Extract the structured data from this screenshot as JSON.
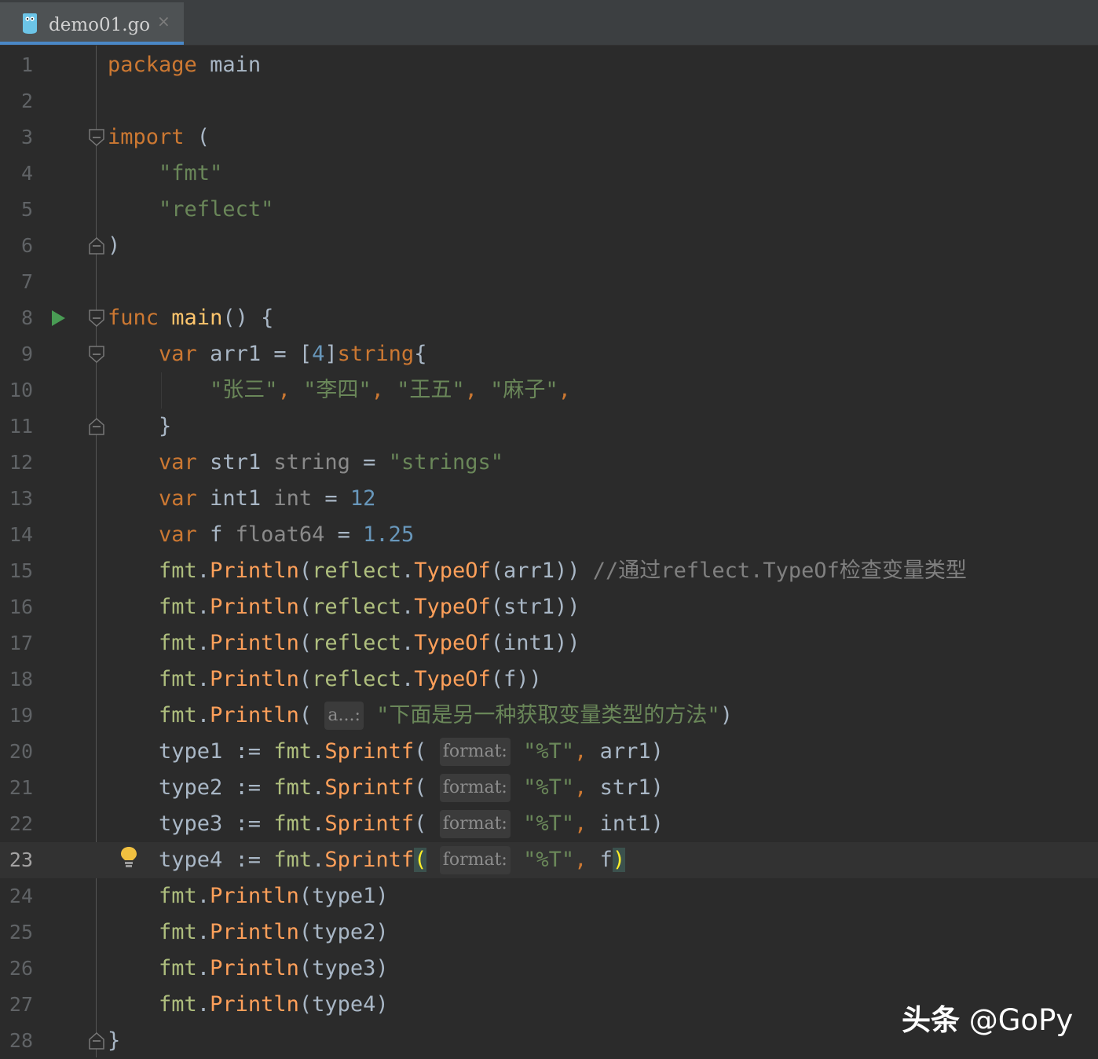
{
  "tab": {
    "filename": "demo01.go",
    "close_glyph": "×",
    "icon": "go-file-icon"
  },
  "editor": {
    "current_line": 23,
    "lines": [
      {
        "n": "1",
        "t": [
          {
            "c": "kw",
            "v": "package"
          },
          {
            "c": "",
            "v": " "
          },
          {
            "c": "typ",
            "v": "main"
          }
        ]
      },
      {
        "n": "2",
        "t": []
      },
      {
        "n": "3",
        "t": [
          {
            "c": "kw",
            "v": "import"
          },
          {
            "c": "",
            "v": " ("
          }
        ]
      },
      {
        "n": "4",
        "t": [
          {
            "c": "",
            "v": "    "
          },
          {
            "c": "str",
            "v": "\"fmt\""
          }
        ]
      },
      {
        "n": "5",
        "t": [
          {
            "c": "",
            "v": "    "
          },
          {
            "c": "str",
            "v": "\"reflect\""
          }
        ]
      },
      {
        "n": "6",
        "t": [
          {
            "c": "",
            "v": ")"
          }
        ]
      },
      {
        "n": "7",
        "t": []
      },
      {
        "n": "8",
        "t": [
          {
            "c": "kw",
            "v": "func"
          },
          {
            "c": "",
            "v": " "
          },
          {
            "c": "fn",
            "v": "main"
          },
          {
            "c": "",
            "v": "() {"
          }
        ]
      },
      {
        "n": "9",
        "t": [
          {
            "c": "",
            "v": "    "
          },
          {
            "c": "kw",
            "v": "var"
          },
          {
            "c": "",
            "v": " arr1 = ["
          },
          {
            "c": "num",
            "v": "4"
          },
          {
            "c": "",
            "v": "]"
          },
          {
            "c": "kw",
            "v": "string"
          },
          {
            "c": "",
            "v": "{"
          }
        ]
      },
      {
        "n": "10",
        "t": [
          {
            "c": "",
            "v": "        "
          },
          {
            "c": "str",
            "v": "\"张三\""
          },
          {
            "c": "kw",
            "v": ", "
          },
          {
            "c": "str",
            "v": "\"李四\""
          },
          {
            "c": "kw",
            "v": ", "
          },
          {
            "c": "str",
            "v": "\"王五\""
          },
          {
            "c": "kw",
            "v": ", "
          },
          {
            "c": "str",
            "v": "\"麻子\""
          },
          {
            "c": "kw",
            "v": ","
          }
        ]
      },
      {
        "n": "11",
        "t": [
          {
            "c": "",
            "v": "    }"
          }
        ]
      },
      {
        "n": "12",
        "t": [
          {
            "c": "",
            "v": "    "
          },
          {
            "c": "kw",
            "v": "var"
          },
          {
            "c": "",
            "v": " str1 "
          },
          {
            "c": "gray",
            "v": "string"
          },
          {
            "c": "",
            "v": " = "
          },
          {
            "c": "str",
            "v": "\"strings\""
          }
        ]
      },
      {
        "n": "13",
        "t": [
          {
            "c": "",
            "v": "    "
          },
          {
            "c": "kw",
            "v": "var"
          },
          {
            "c": "",
            "v": " int1 "
          },
          {
            "c": "gray",
            "v": "int"
          },
          {
            "c": "",
            "v": " = "
          },
          {
            "c": "num",
            "v": "12"
          }
        ]
      },
      {
        "n": "14",
        "t": [
          {
            "c": "",
            "v": "    "
          },
          {
            "c": "kw",
            "v": "var"
          },
          {
            "c": "",
            "v": " f "
          },
          {
            "c": "gray",
            "v": "float64"
          },
          {
            "c": "",
            "v": " = "
          },
          {
            "c": "num",
            "v": "1.25"
          }
        ]
      },
      {
        "n": "15",
        "t": [
          {
            "c": "",
            "v": "    "
          },
          {
            "c": "pkg",
            "v": "fmt"
          },
          {
            "c": "",
            "v": "."
          },
          {
            "c": "mth",
            "v": "Println"
          },
          {
            "c": "",
            "v": "("
          },
          {
            "c": "pkg",
            "v": "reflect"
          },
          {
            "c": "",
            "v": "."
          },
          {
            "c": "mth",
            "v": "TypeOf"
          },
          {
            "c": "",
            "v": "(arr1)) "
          },
          {
            "c": "cmt",
            "v": "//通过reflect.TypeOf检查变量类型"
          }
        ]
      },
      {
        "n": "16",
        "t": [
          {
            "c": "",
            "v": "    "
          },
          {
            "c": "pkg",
            "v": "fmt"
          },
          {
            "c": "",
            "v": "."
          },
          {
            "c": "mth",
            "v": "Println"
          },
          {
            "c": "",
            "v": "("
          },
          {
            "c": "pkg",
            "v": "reflect"
          },
          {
            "c": "",
            "v": "."
          },
          {
            "c": "mth",
            "v": "TypeOf"
          },
          {
            "c": "",
            "v": "(str1))"
          }
        ]
      },
      {
        "n": "17",
        "t": [
          {
            "c": "",
            "v": "    "
          },
          {
            "c": "pkg",
            "v": "fmt"
          },
          {
            "c": "",
            "v": "."
          },
          {
            "c": "mth",
            "v": "Println"
          },
          {
            "c": "",
            "v": "("
          },
          {
            "c": "pkg",
            "v": "reflect"
          },
          {
            "c": "",
            "v": "."
          },
          {
            "c": "mth",
            "v": "TypeOf"
          },
          {
            "c": "",
            "v": "(int1))"
          }
        ]
      },
      {
        "n": "18",
        "t": [
          {
            "c": "",
            "v": "    "
          },
          {
            "c": "pkg",
            "v": "fmt"
          },
          {
            "c": "",
            "v": "."
          },
          {
            "c": "mth",
            "v": "Println"
          },
          {
            "c": "",
            "v": "("
          },
          {
            "c": "pkg",
            "v": "reflect"
          },
          {
            "c": "",
            "v": "."
          },
          {
            "c": "mth",
            "v": "TypeOf"
          },
          {
            "c": "",
            "v": "(f))"
          }
        ]
      },
      {
        "n": "19",
        "t": [
          {
            "c": "",
            "v": "    "
          },
          {
            "c": "pkg",
            "v": "fmt"
          },
          {
            "c": "",
            "v": "."
          },
          {
            "c": "mth",
            "v": "Println"
          },
          {
            "c": "",
            "v": "( "
          },
          {
            "c": "hint",
            "v": "a...:"
          },
          {
            "c": "",
            "v": " "
          },
          {
            "c": "str",
            "v": "\"下面是另一种获取变量类型的方法\""
          },
          {
            "c": "",
            "v": ")"
          }
        ]
      },
      {
        "n": "20",
        "t": [
          {
            "c": "",
            "v": "    type1 := "
          },
          {
            "c": "pkg",
            "v": "fmt"
          },
          {
            "c": "",
            "v": "."
          },
          {
            "c": "mth",
            "v": "Sprintf"
          },
          {
            "c": "",
            "v": "( "
          },
          {
            "c": "hint",
            "v": "format:"
          },
          {
            "c": "",
            "v": " "
          },
          {
            "c": "str",
            "v": "\"%T\""
          },
          {
            "c": "kw",
            "v": ", "
          },
          {
            "c": "",
            "v": "arr1)"
          }
        ]
      },
      {
        "n": "21",
        "t": [
          {
            "c": "",
            "v": "    type2 := "
          },
          {
            "c": "pkg",
            "v": "fmt"
          },
          {
            "c": "",
            "v": "."
          },
          {
            "c": "mth",
            "v": "Sprintf"
          },
          {
            "c": "",
            "v": "( "
          },
          {
            "c": "hint",
            "v": "format:"
          },
          {
            "c": "",
            "v": " "
          },
          {
            "c": "str",
            "v": "\"%T\""
          },
          {
            "c": "kw",
            "v": ", "
          },
          {
            "c": "",
            "v": "str1)"
          }
        ]
      },
      {
        "n": "22",
        "t": [
          {
            "c": "",
            "v": "    type3 := "
          },
          {
            "c": "pkg",
            "v": "fmt"
          },
          {
            "c": "",
            "v": "."
          },
          {
            "c": "mth",
            "v": "Sprintf"
          },
          {
            "c": "",
            "v": "( "
          },
          {
            "c": "hint",
            "v": "format:"
          },
          {
            "c": "",
            "v": " "
          },
          {
            "c": "str",
            "v": "\"%T\""
          },
          {
            "c": "kw",
            "v": ", "
          },
          {
            "c": "",
            "v": "int1)"
          }
        ]
      },
      {
        "n": "23",
        "t": [
          {
            "c": "",
            "v": "    type4 := "
          },
          {
            "c": "pkg",
            "v": "fmt"
          },
          {
            "c": "",
            "v": "."
          },
          {
            "c": "mth",
            "v": "Sprintf"
          },
          {
            "c": "brace-hl",
            "v": "("
          },
          {
            "c": "",
            "v": " "
          },
          {
            "c": "hint",
            "v": "format:"
          },
          {
            "c": "",
            "v": " "
          },
          {
            "c": "str",
            "v": "\"%T\""
          },
          {
            "c": "kw",
            "v": ", "
          },
          {
            "c": "",
            "v": "f"
          },
          {
            "c": "brace-hl",
            "v": ")"
          }
        ]
      },
      {
        "n": "24",
        "t": [
          {
            "c": "",
            "v": "    "
          },
          {
            "c": "pkg",
            "v": "fmt"
          },
          {
            "c": "",
            "v": "."
          },
          {
            "c": "mth",
            "v": "Println"
          },
          {
            "c": "",
            "v": "(type1)"
          }
        ]
      },
      {
        "n": "25",
        "t": [
          {
            "c": "",
            "v": "    "
          },
          {
            "c": "pkg",
            "v": "fmt"
          },
          {
            "c": "",
            "v": "."
          },
          {
            "c": "mth",
            "v": "Println"
          },
          {
            "c": "",
            "v": "(type2)"
          }
        ]
      },
      {
        "n": "26",
        "t": [
          {
            "c": "",
            "v": "    "
          },
          {
            "c": "pkg",
            "v": "fmt"
          },
          {
            "c": "",
            "v": "."
          },
          {
            "c": "mth",
            "v": "Println"
          },
          {
            "c": "",
            "v": "(type3)"
          }
        ]
      },
      {
        "n": "27",
        "t": [
          {
            "c": "",
            "v": "    "
          },
          {
            "c": "pkg",
            "v": "fmt"
          },
          {
            "c": "",
            "v": "."
          },
          {
            "c": "mth",
            "v": "Println"
          },
          {
            "c": "",
            "v": "(type4)"
          }
        ]
      },
      {
        "n": "28",
        "t": [
          {
            "c": "",
            "v": "}"
          }
        ]
      }
    ],
    "fold_markers": [
      {
        "line": 3,
        "kind": "open"
      },
      {
        "line": 6,
        "kind": "close"
      },
      {
        "line": 8,
        "kind": "open"
      },
      {
        "line": 9,
        "kind": "open"
      },
      {
        "line": 11,
        "kind": "close"
      },
      {
        "line": 28,
        "kind": "close"
      }
    ],
    "run_gutter_line": 8,
    "intention_bulb_line": 23
  },
  "watermark": {
    "brand": "头条",
    "handle": " @GoPy"
  },
  "colors": {
    "background": "#2b2b2b",
    "keyword": "#cc7832",
    "string": "#6a8759",
    "number": "#6897bb",
    "function": "#ffc66d",
    "run_icon": "#499c54",
    "bulb": "#f0c040",
    "tab_underline": "#4a88c7"
  }
}
